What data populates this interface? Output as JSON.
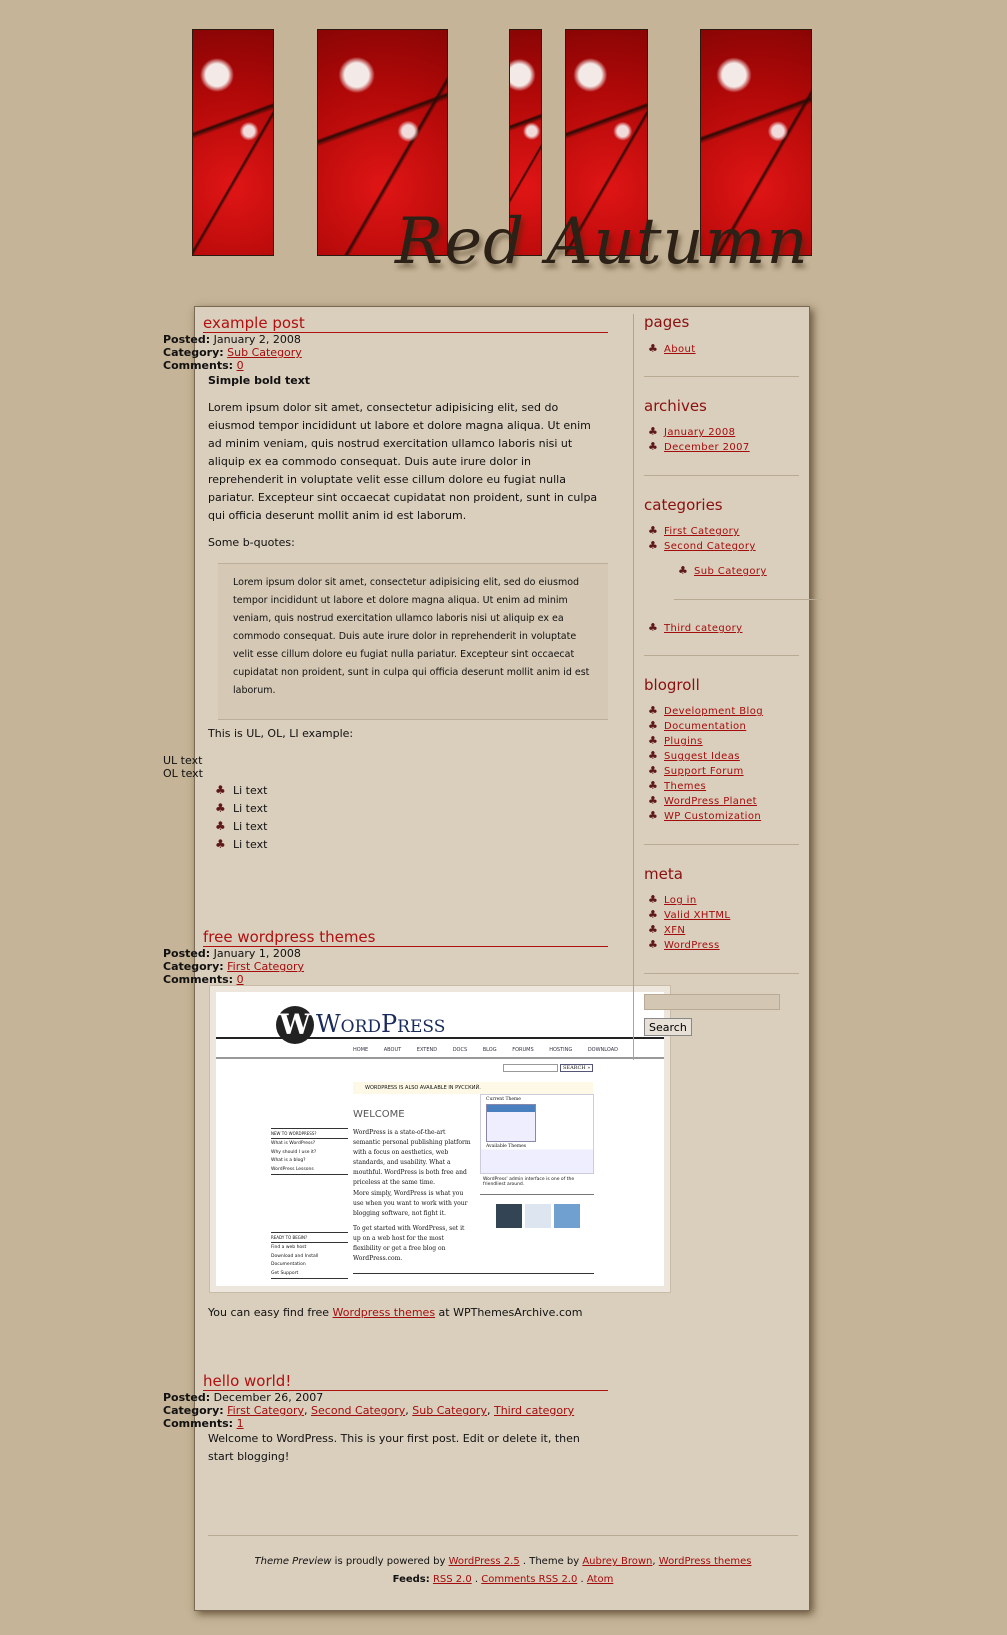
{
  "header": {
    "logo_text": "Red Autumn"
  },
  "posts": [
    {
      "title": "example post",
      "posted_label": "Posted:",
      "date": "January 2, 2008",
      "category_label": "Category:",
      "categories": [
        "Sub Category"
      ],
      "comments_label": "Comments:",
      "comments": "0",
      "bold": "Simple bold text",
      "paragraph": "Lorem ipsum dolor sit amet, consectetur adipisicing elit, sed do eiusmod tempor incididunt ut labore et dolore magna aliqua. Ut enim ad minim veniam, quis nostrud exercitation ullamco laboris nisi ut aliquip ex ea commodo consequat. Duis aute irure dolor in reprehenderit in voluptate velit esse cillum dolore eu fugiat nulla pariatur. Excepteur sint occaecat cupidatat non proident, sunt in culpa qui officia deserunt mollit anim id est laborum.",
      "bq_intro": "Some b-quotes:",
      "blockquote": "Lorem ipsum dolor sit amet, consectetur adipisicing elit, sed do eiusmod tempor incididunt ut labore et dolore magna aliqua. Ut enim ad minim veniam, quis nostrud exercitation ullamco laboris nisi ut aliquip ex ea commodo consequat. Duis aute irure dolor in reprehenderit in voluptate velit esse cillum dolore eu fugiat nulla pariatur. Excepteur sint occaecat cupidatat non proident, sunt in culpa qui officia deserunt mollit anim id est laborum.",
      "list_intro": "This is UL, OL, LI example:",
      "ul_text": "UL text",
      "ol_text": "OL text",
      "li": [
        "Li text",
        "Li text",
        "Li text",
        "Li text"
      ]
    },
    {
      "title": "free wordpress themes",
      "posted_label": "Posted:",
      "date": "January 1, 2008",
      "category_label": "Category:",
      "categories": [
        "First Category"
      ],
      "comments_label": "Comments:",
      "comments": "0",
      "screenshot": {
        "logo": "WordPress",
        "nav": [
          "HOME",
          "ABOUT",
          "EXTEND",
          "DOCS",
          "BLOG",
          "FORUMS",
          "HOSTING",
          "DOWNLOAD"
        ],
        "search": "SEARCH »",
        "notice": "WORDPRESS IS ALSO AVAILABLE IN РУССКИЙ.",
        "welcome": "WELCOME",
        "new_heading": "NEW TO WORDPRESS?",
        "new_links": [
          "What is WordPress?",
          "Why should I use it?",
          "What is a blog?",
          "WordPress Lessons"
        ],
        "ready_heading": "READY TO BEGIN?",
        "ready_links": [
          "Find a web host",
          "Download and Install",
          "Documentation",
          "Get Support"
        ],
        "intro": "WordPress is a state-of-the-art semantic personal publishing platform with a focus on aesthetics, web standards, and usability. What a mouthful. WordPress is both free and priceless at the same time.",
        "intro2": "More simply, WordPress is what you use when you want to work with your blogging software, not fight it.",
        "intro3": "To get started with WordPress, set it up on a web host for the most flexibility or get a free blog on WordPress.com.",
        "current_theme": "Current Theme",
        "available": "Available Themes",
        "caption": "WordPress' admin interface is one of the friendliest around."
      },
      "text_before": "You can easy find free ",
      "link": "Wordpress themes",
      "text_after": " at WPThemesArchive.com"
    },
    {
      "title": "hello world!",
      "posted_label": "Posted:",
      "date": "December 26, 2007",
      "category_label": "Category:",
      "categories": [
        "First Category",
        "Second Category",
        "Sub Category",
        "Third category"
      ],
      "comments_label": "Comments:",
      "comments": "1",
      "paragraph": "Welcome to WordPress. This is your first post. Edit or delete it, then start blogging!"
    }
  ],
  "sidebar": {
    "pages": {
      "title": "pages",
      "items": [
        "About"
      ]
    },
    "archives": {
      "title": "archives",
      "items": [
        "January 2008",
        "December 2007"
      ]
    },
    "categories": {
      "title": "categories",
      "items": [
        "First Category",
        "Second Category",
        "Sub Category",
        "Third category"
      ]
    },
    "blogroll": {
      "title": "blogroll",
      "items": [
        "Development Blog",
        "Documentation",
        "Plugins",
        "Suggest Ideas",
        "Support Forum",
        "Themes",
        "WordPress Planet",
        "WP Customization"
      ]
    },
    "meta": {
      "title": "meta",
      "items": [
        "Log in",
        "Valid XHTML",
        "XFN",
        "WordPress"
      ]
    },
    "search": {
      "value": "",
      "button": "Search"
    }
  },
  "footer": {
    "site": "Theme Preview",
    "powered": " is proudly powered by ",
    "wp_link": "WordPress 2.5",
    "theme_by": " . Theme by ",
    "author": "Aubrey Brown",
    "sep": ", ",
    "themes_link": "WordPress themes",
    "feeds_label": "Feeds:",
    "rss": "RSS 2.0",
    "comments_rss": "Comments RSS 2.0",
    "atom": "Atom",
    "dot": " . "
  },
  "colors": {
    "background": "#c5b497",
    "content": "#dacebd",
    "accent": "#b01010",
    "link": "#a30d0d"
  }
}
